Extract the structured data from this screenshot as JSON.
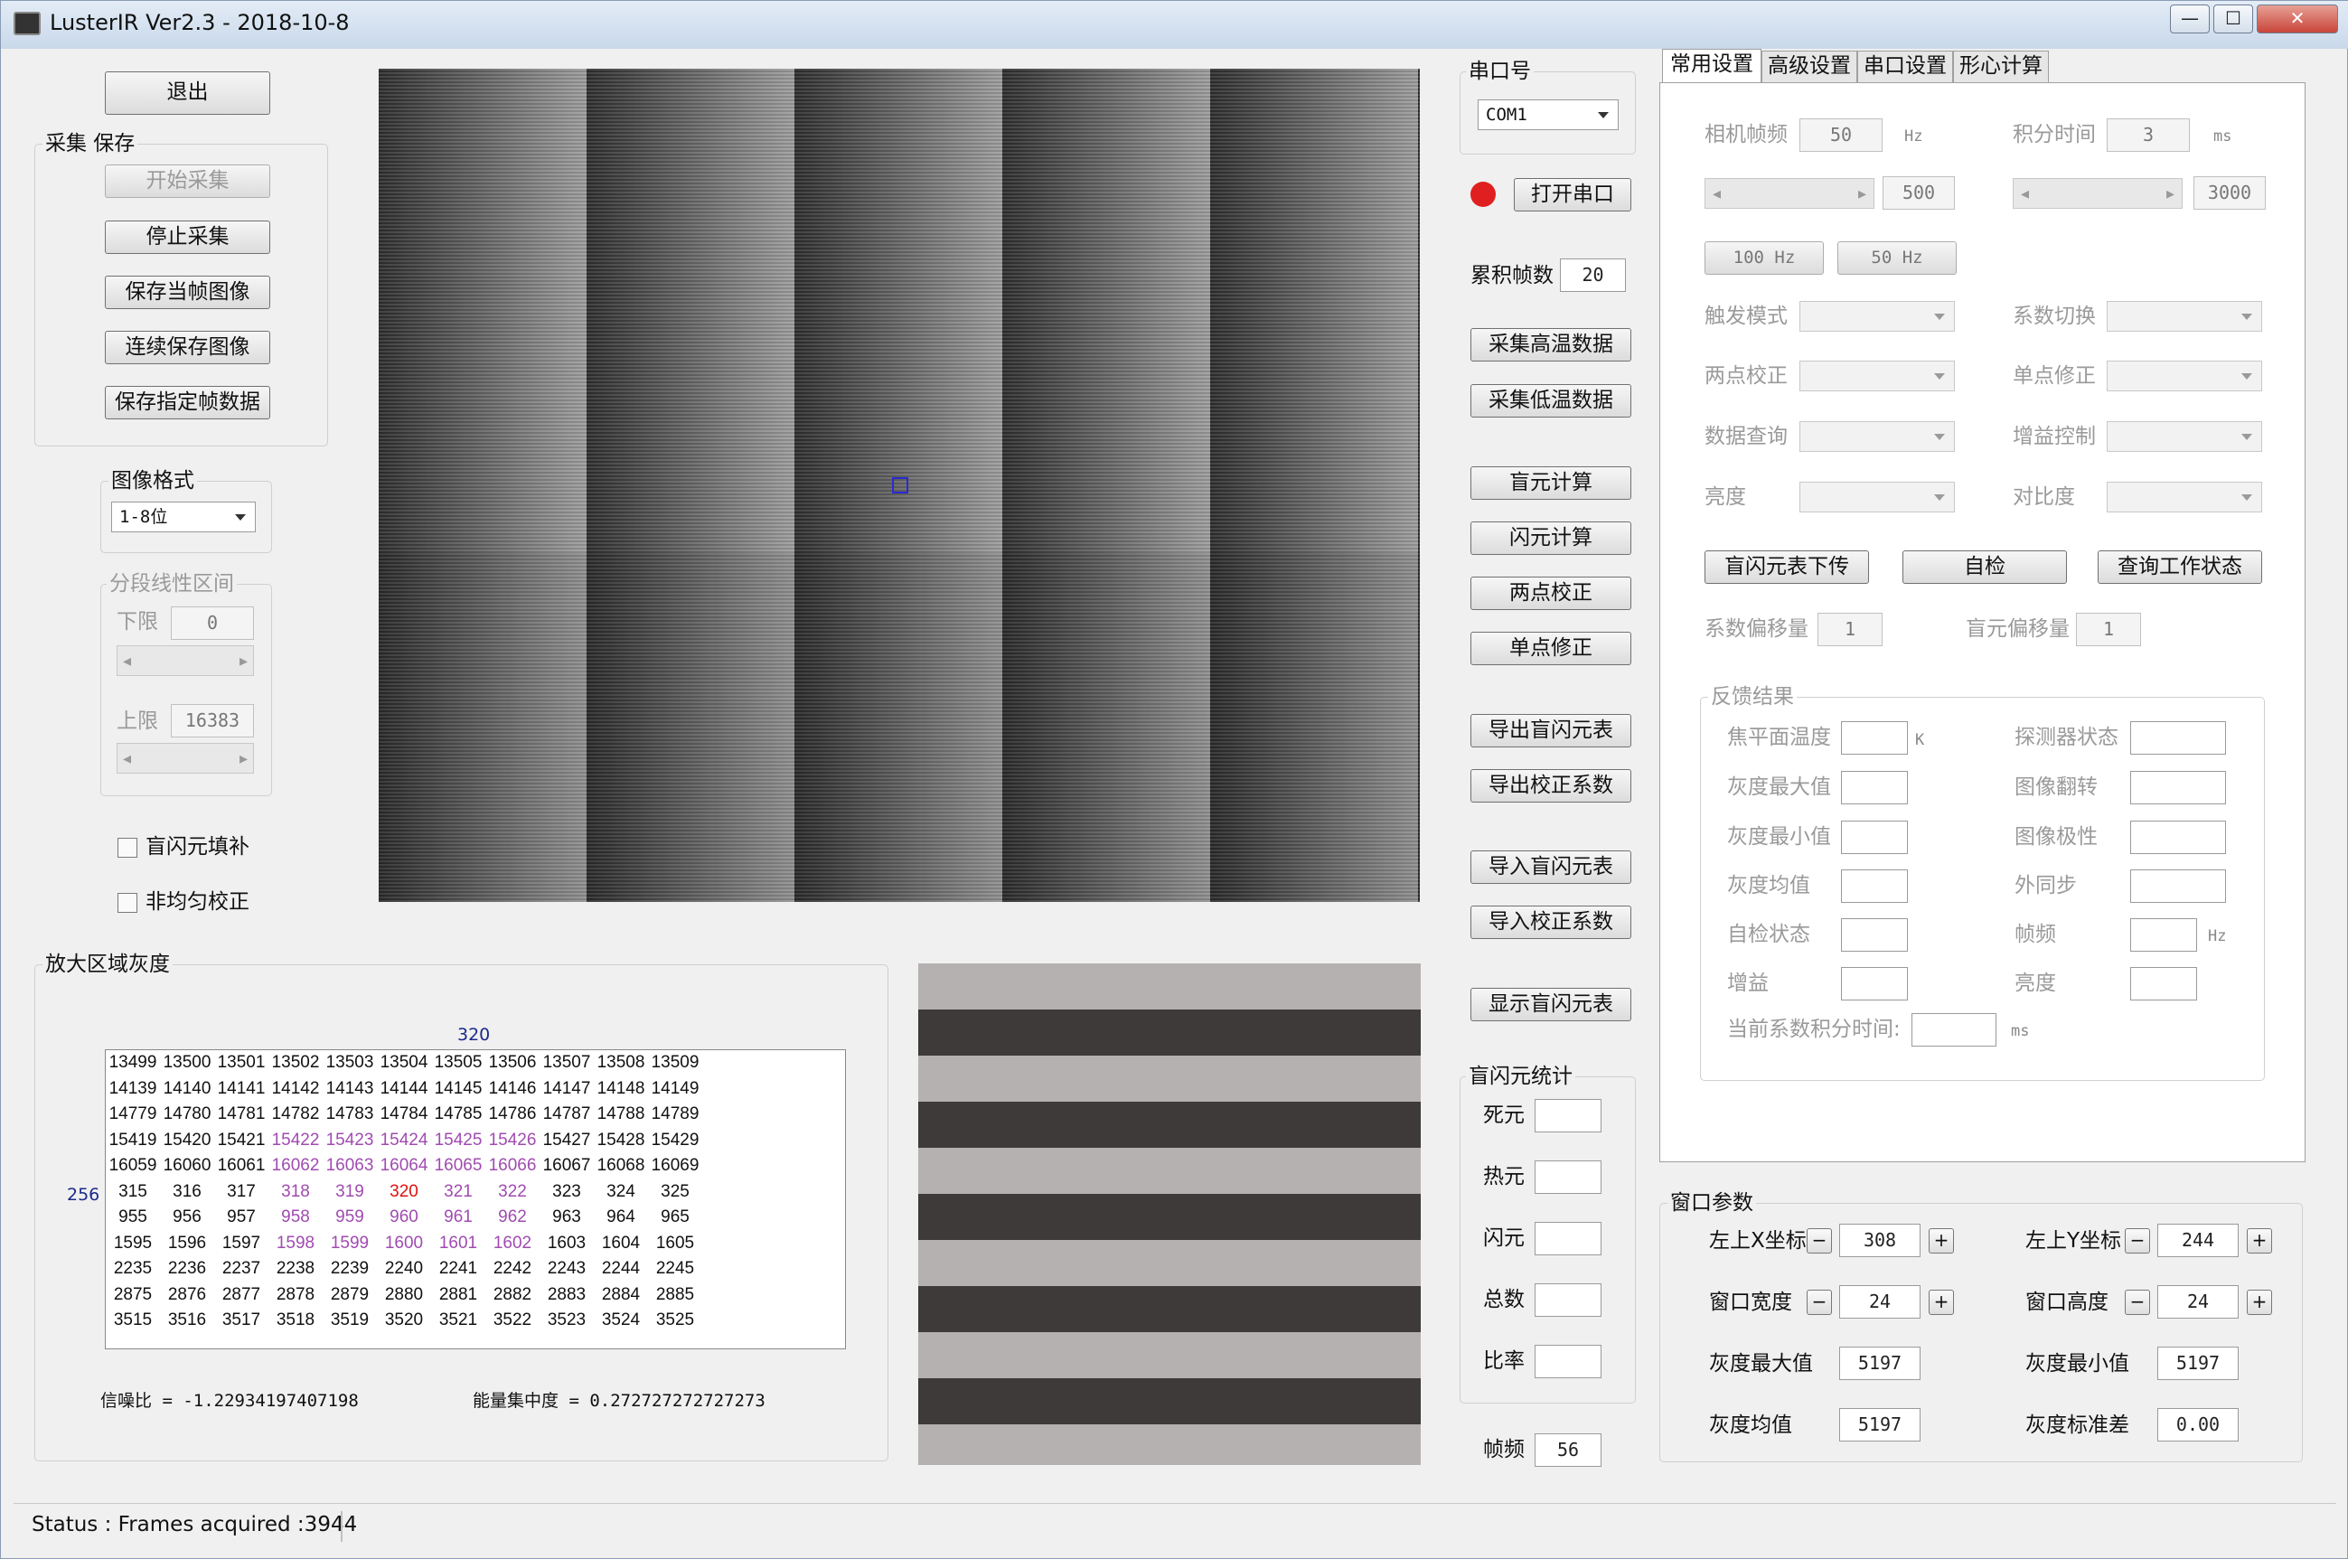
{
  "window": {
    "title": "LusterIR Ver2.3 - 2018-10-8",
    "controls": [
      "—",
      "☐",
      "✕"
    ]
  },
  "left": {
    "exit_label": "退出",
    "capture_group": "采集 保存",
    "capture_buttons": [
      "开始采集",
      "停止采集",
      "保存当帧图像",
      "连续保存图像",
      "保存指定帧数据"
    ],
    "format_group": "图像格式",
    "format_value": "1-8位",
    "piecewise_group": "分段线性区间",
    "lower_label": "下限",
    "lower_value": "0",
    "upper_label": "上限",
    "upper_value": "16383",
    "check_blind": "盲闪元填补",
    "check_nonuniform": "非均匀校正"
  },
  "zoom": {
    "group": "放大区域灰度",
    "col_marker": "320",
    "row_marker": "256",
    "rows": [
      [
        "13499",
        "13500",
        "13501",
        "13502",
        "13503",
        "13504",
        "13505",
        "13506",
        "13507",
        "13508",
        "13509"
      ],
      [
        "14139",
        "14140",
        "14141",
        "14142",
        "14143",
        "14144",
        "14145",
        "14146",
        "14147",
        "14148",
        "14149"
      ],
      [
        "14779",
        "14780",
        "14781",
        "14782",
        "14783",
        "14784",
        "14785",
        "14786",
        "14787",
        "14788",
        "14789"
      ],
      [
        "15419",
        "15420",
        "15421",
        "15422",
        "15423",
        "15424",
        "15425",
        "15426",
        "15427",
        "15428",
        "15429"
      ],
      [
        "16059",
        "16060",
        "16061",
        "16062",
        "16063",
        "16064",
        "16065",
        "16066",
        "16067",
        "16068",
        "16069"
      ],
      [
        "315",
        "316",
        "317",
        "318",
        "319",
        "320",
        "321",
        "322",
        "323",
        "324",
        "325"
      ],
      [
        "955",
        "956",
        "957",
        "958",
        "959",
        "960",
        "961",
        "962",
        "963",
        "964",
        "965"
      ],
      [
        "1595",
        "1596",
        "1597",
        "1598",
        "1599",
        "1600",
        "1601",
        "1602",
        "1603",
        "1604",
        "1605"
      ],
      [
        "2235",
        "2236",
        "2237",
        "2238",
        "2239",
        "2240",
        "2241",
        "2242",
        "2243",
        "2244",
        "2245"
      ],
      [
        "2875",
        "2876",
        "2877",
        "2878",
        "2879",
        "2880",
        "2881",
        "2882",
        "2883",
        "2884",
        "2885"
      ],
      [
        "3515",
        "3516",
        "3517",
        "3518",
        "3519",
        "3520",
        "3521",
        "3522",
        "3523",
        "3524",
        "3525"
      ]
    ],
    "snr": "信噪比 = -1.22934197407198",
    "energy": "能量集中度 = 0.272727272727273"
  },
  "middle": {
    "port_group": "串口号",
    "port_value": "COM1",
    "status_color": "#e02020",
    "open_port": "打开串口",
    "accum_label": "累积帧数",
    "accum_value": "20",
    "buttons_a": [
      "采集高温数据",
      "采集低温数据"
    ],
    "buttons_b": [
      "盲元计算",
      "闪元计算",
      "两点校正",
      "单点修正"
    ],
    "buttons_c": [
      "导出盲闪元表",
      "导出校正系数"
    ],
    "buttons_d": [
      "导入盲闪元表",
      "导入校正系数"
    ],
    "show_table": "显示盲闪元表",
    "stats_group": "盲闪元统计",
    "stats_labels": [
      "死元",
      "热元",
      "闪元",
      "总数",
      "比率"
    ],
    "fps_label": "帧频",
    "fps_value": "56"
  },
  "right": {
    "tabs": [
      "常用设置",
      "高级设置",
      "串口设置",
      "形心计算"
    ],
    "cam_fps_label": "相机帧频",
    "cam_fps_value": "50",
    "cam_fps_unit": "Hz",
    "int_time_label": "积分时间",
    "int_time_value": "3",
    "int_time_unit": "ms",
    "slider1_value": "500",
    "slider2_value": "3000",
    "hz100": "100 Hz",
    "hz50": "50 Hz",
    "combo_labels_left": [
      "触发模式",
      "两点校正",
      "数据查询",
      "亮度"
    ],
    "combo_labels_right": [
      "系数切换",
      "单点修正",
      "增益控制",
      "对比度"
    ],
    "action_buttons": [
      "盲闪元表下传",
      "自检",
      "查询工作状态"
    ],
    "coef_offset_label": "系数偏移量",
    "coef_offset_value": "1",
    "blind_offset_label": "盲元偏移量",
    "blind_offset_value": "1",
    "feedback_group": "反馈结果",
    "fb_left": [
      "焦平面温度",
      "灰度最大值",
      "灰度最小值",
      "灰度均值",
      "自检状态",
      "增益"
    ],
    "fb_right": [
      "探测器状态",
      "图像翻转",
      "图像极性",
      "外同步",
      "帧频",
      "亮度"
    ],
    "unit_k": "K",
    "unit_hz": "Hz",
    "cur_int_label": "当前系数积分时间:",
    "cur_int_unit": "ms"
  },
  "window_params": {
    "group": "窗口参数",
    "x_label": "左上X坐标",
    "x_value": "308",
    "y_label": "左上Y坐标",
    "y_value": "244",
    "w_label": "窗口宽度",
    "w_value": "24",
    "h_label": "窗口高度",
    "h_value": "24",
    "max_label": "灰度最大值",
    "max_value": "5197",
    "min_label": "灰度最小值",
    "min_value": "5197",
    "mean_label": "灰度均值",
    "mean_value": "5197",
    "std_label": "灰度标准差",
    "std_value": "0.00"
  },
  "status": {
    "text": "Status :  Frames acquired :3944"
  }
}
